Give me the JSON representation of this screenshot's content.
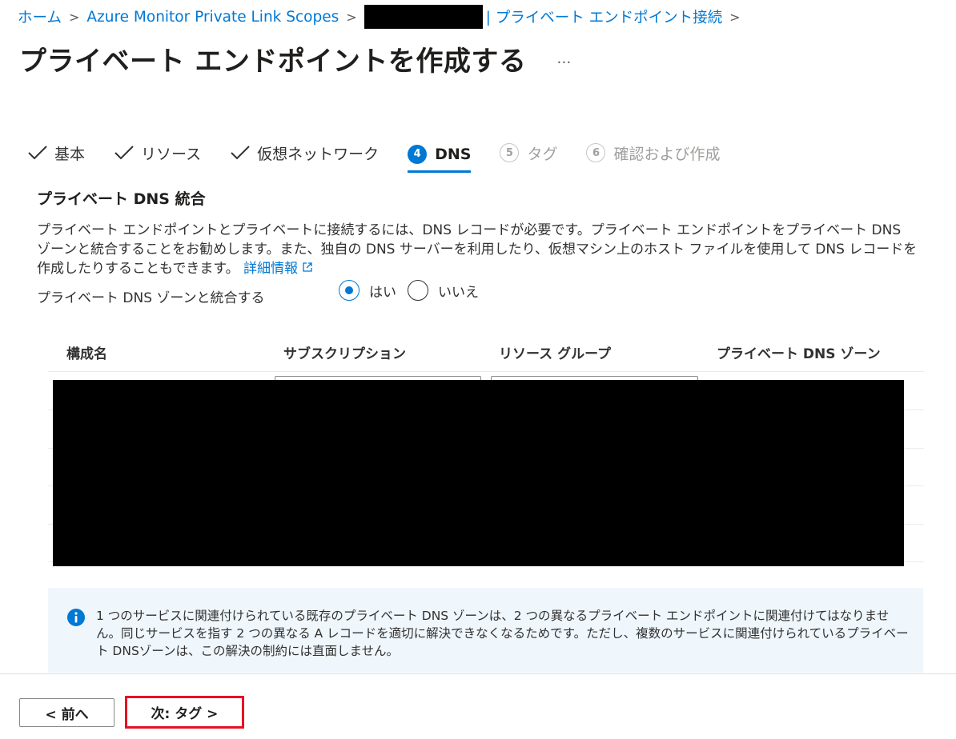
{
  "breadcrumb": {
    "items": [
      "ホーム",
      "Azure Monitor Private Link Scopes",
      "| プライベート エンドポイント接続"
    ]
  },
  "page": {
    "title": "プライベート エンドポイントを作成する",
    "more_label": "…"
  },
  "tabs": [
    {
      "label": "基本",
      "state": "done"
    },
    {
      "label": "リソース",
      "state": "done"
    },
    {
      "label": "仮想ネットワーク",
      "state": "done"
    },
    {
      "number": "4",
      "label": "DNS",
      "state": "active"
    },
    {
      "number": "5",
      "label": "タグ",
      "state": "disabled"
    },
    {
      "number": "6",
      "label": "確認および作成",
      "state": "disabled"
    }
  ],
  "dns": {
    "section_title": "プライベート DNS 統合",
    "description": "プライベート エンドポイントとプライベートに接続するには、DNS レコードが必要です。プライベート エンドポイントをプライベート DNS ゾーンと統合することをお勧めします。また、独自の DNS サーバーを利用したり、仮想マシン上のホスト ファイルを使用して DNS レコードを作成したりすることもできます。",
    "learn_more": "詳細情報",
    "integrate_label": "プライベート DNS ゾーンと統合する",
    "options": {
      "yes": "はい",
      "no": "いいえ"
    },
    "selected": "yes"
  },
  "table": {
    "columns": [
      "構成名",
      "サブスクリプション",
      "リソース グループ",
      "プライベート DNS ゾーン"
    ]
  },
  "info": {
    "text": "1 つのサービスに関連付けられている既存のプライベート DNS ゾーンは、2 つの異なるプライベート エンドポイントに関連付けてはなりません。同じサービスを指す 2 つの異なる A レコードを適切に解決できなくなるためです。ただし、複数のサービスに関連付けられているプライベート DNSゾーンは、この解決の制約には直面しません。"
  },
  "footer": {
    "prev_label": "< 前へ",
    "next_label": "次: タグ >"
  },
  "colors": {
    "accent": "#0078d4",
    "highlight": "#e81123",
    "info_bg": "#eff6fc",
    "redaction": "#000000"
  },
  "icons": {
    "tab_done": "checkmark-icon",
    "breadcrumb_separator": "chevron-right-icon",
    "info": "info-icon",
    "external_link": "external-link-icon"
  }
}
